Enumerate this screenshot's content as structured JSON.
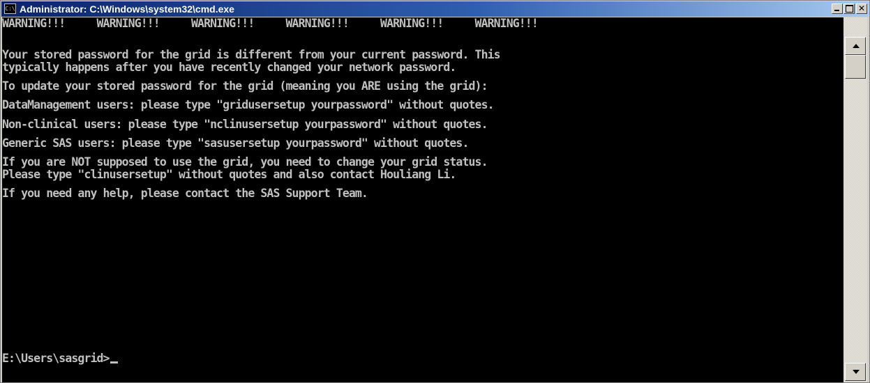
{
  "window": {
    "title": "Administrator: C:\\Windows\\system32\\cmd.exe",
    "icon_text": "C:\\",
    "controls": {
      "minimize": "minimize",
      "maximize": "maximize",
      "close": "close"
    }
  },
  "console": {
    "background_color": "#000000",
    "text_color": "#c0c0c0",
    "lines": [
      "WARNING!!!     WARNING!!!     WARNING!!!     WARNING!!!     WARNING!!!     WARNING!!!",
      "",
      "Your stored password for the grid is different from your current password. This",
      "typically happens after you have recently changed your network password.",
      "To update your stored password for the grid (meaning you ARE using the grid):",
      "DataManagement users: please type \"gridusersetup yourpassword\" without quotes.",
      "Non-clinical users: please type \"nclinusersetup yourpassword\" without quotes.",
      "Generic SAS users: please type \"sasusersetup yourpassword\" without quotes.",
      "If you are NOT supposed to use the grid, you need to change your grid status.",
      "Please type \"clinusersetup\" without quotes and also contact Houliang Li.",
      "If you need any help, please contact the SAS Support Team."
    ],
    "prompt": "E:\\Users\\sasgrid>"
  },
  "scrollbar": {
    "up_icon": "arrow-up-icon",
    "down_icon": "arrow-down-icon"
  }
}
